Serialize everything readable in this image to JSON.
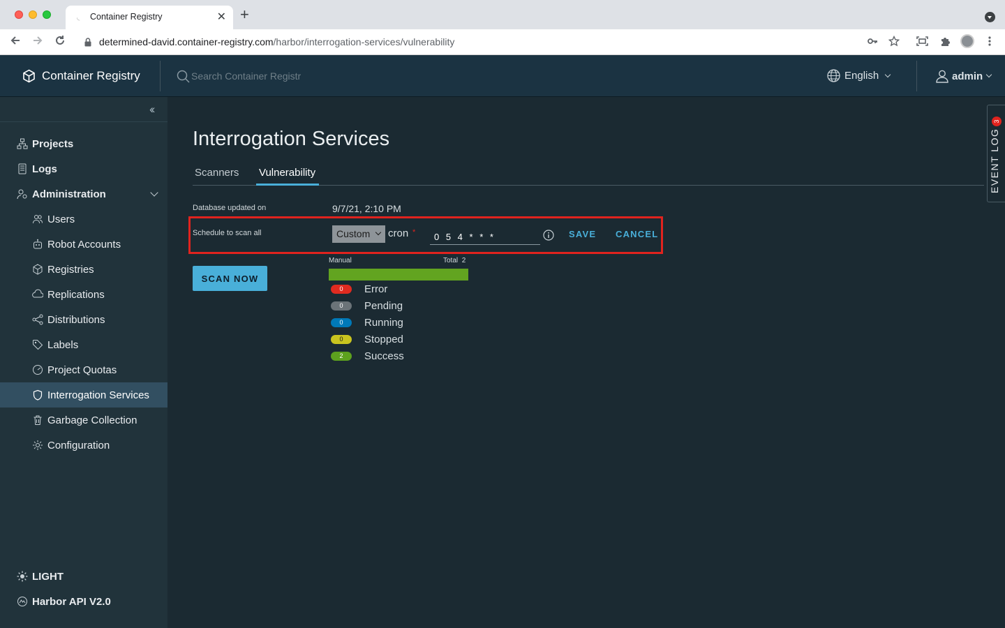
{
  "browser": {
    "tab_title": "Container Registry",
    "new_tab_label": "+",
    "url_domain": "determined-david.container-registry.com",
    "url_path": "/harbor/interrogation-services/vulnerability"
  },
  "header": {
    "brand": "Container Registry",
    "search_placeholder": "Search Container Registr",
    "language": "English",
    "user": "admin"
  },
  "sidebar": {
    "items": [
      {
        "label": "Projects",
        "icon": "projects-icon"
      },
      {
        "label": "Logs",
        "icon": "logs-icon"
      },
      {
        "label": "Administration",
        "icon": "administration-icon"
      },
      {
        "label": "Users",
        "icon": "users-icon"
      },
      {
        "label": "Robot Accounts",
        "icon": "robot-icon"
      },
      {
        "label": "Registries",
        "icon": "registries-icon"
      },
      {
        "label": "Replications",
        "icon": "replications-icon"
      },
      {
        "label": "Distributions",
        "icon": "distributions-icon"
      },
      {
        "label": "Labels",
        "icon": "labels-icon"
      },
      {
        "label": "Project Quotas",
        "icon": "quotas-icon"
      },
      {
        "label": "Interrogation Services",
        "icon": "shield-icon"
      },
      {
        "label": "Garbage Collection",
        "icon": "trash-icon"
      },
      {
        "label": "Configuration",
        "icon": "gear-icon"
      }
    ],
    "theme_toggle": "LIGHT",
    "api_link": "Harbor API V2.0"
  },
  "main": {
    "title": "Interrogation Services",
    "tabs": [
      "Scanners",
      "Vulnerability"
    ],
    "db_updated_label": "Database updated on",
    "db_updated_value": "9/7/21, 2:10 PM",
    "schedule_label": "Schedule to scan all",
    "schedule_type": "Custom",
    "cron_label": "cron",
    "required_mark": "*",
    "cron_value": "0 5 4 * * *",
    "save_label": "SAVE",
    "cancel_label": "CANCEL",
    "scan_now_label": "SCAN NOW",
    "manual_label": "Manual",
    "total_label": "Total",
    "total_value": "2",
    "progress_fraction": 1.0,
    "statuses": [
      {
        "name": "Error",
        "count": "0",
        "color": "#e02b20",
        "text": "#ffffff"
      },
      {
        "name": "Pending",
        "count": "0",
        "color": "#6b7378",
        "text": "#ffffff"
      },
      {
        "name": "Running",
        "count": "0",
        "color": "#0079b8",
        "text": "#ffffff"
      },
      {
        "name": "Stopped",
        "count": "0",
        "color": "#c9c41f",
        "text": "#1b1b1b"
      },
      {
        "name": "Success",
        "count": "2",
        "color": "#5da11e",
        "text": "#ffffff"
      }
    ]
  },
  "event_log": {
    "label": "EVENT LOG",
    "count": "3"
  },
  "colors": {
    "accent": "#49afd9",
    "header_bg": "#1b3342",
    "sidebar_bg": "#21333b",
    "main_bg": "#1b2a32",
    "highlight": "#e0231e"
  }
}
